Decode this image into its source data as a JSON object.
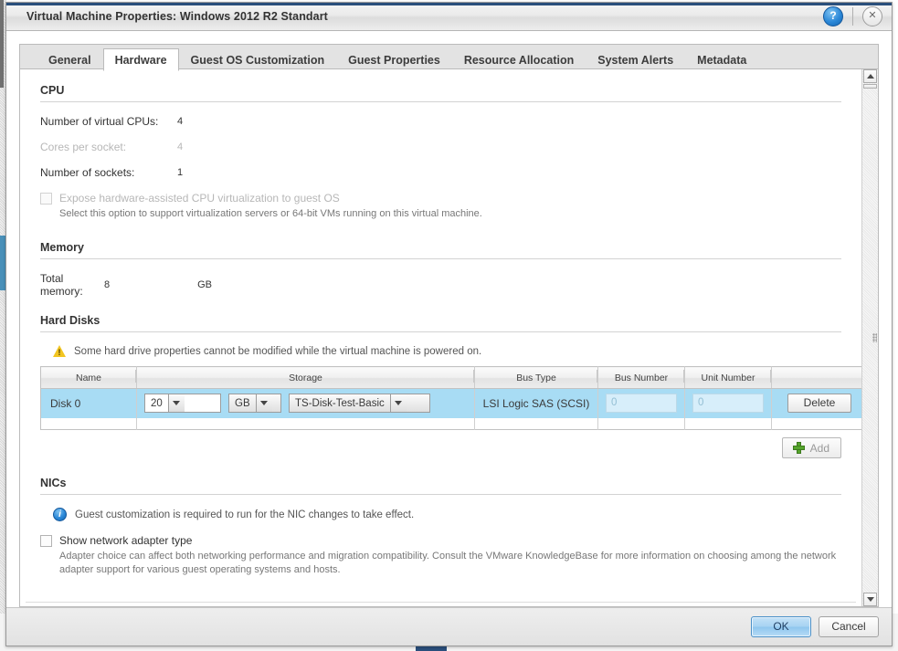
{
  "window": {
    "title": "Virtual Machine Properties: Windows 2012 R2 Standart",
    "help_icon": "help-circle-icon",
    "help_glyph": "?",
    "close_icon": "close-icon",
    "close_glyph": "✕"
  },
  "tabs": [
    {
      "label": "General",
      "active": false
    },
    {
      "label": "Hardware",
      "active": true
    },
    {
      "label": "Guest OS Customization",
      "active": false
    },
    {
      "label": "Guest Properties",
      "active": false
    },
    {
      "label": "Resource Allocation",
      "active": false
    },
    {
      "label": "System Alerts",
      "active": false
    },
    {
      "label": "Metadata",
      "active": false
    }
  ],
  "cpu": {
    "section_title": "CPU",
    "virtual_cpus_label": "Number of virtual CPUs:",
    "virtual_cpus_value": "4",
    "cores_per_socket_label": "Cores per socket:",
    "cores_per_socket_value": "4",
    "sockets_label": "Number of sockets:",
    "sockets_value": "1",
    "expose_hv_label": "Expose hardware-assisted CPU virtualization to guest OS",
    "expose_hv_hint": "Select this option to support virtualization servers or 64-bit VMs running on this virtual machine.",
    "expose_hv_checked": false
  },
  "memory": {
    "section_title": "Memory",
    "total_label": "Total memory:",
    "total_value": "8",
    "total_unit": "GB"
  },
  "hard_disks": {
    "section_title": "Hard Disks",
    "warning_icon": "warning-triangle-icon",
    "warning_text": "Some hard drive properties cannot be modified while the virtual machine is powered on.",
    "columns": [
      "Name",
      "Storage",
      "Bus Type",
      "Bus Number",
      "Unit Number",
      ""
    ],
    "rows": [
      {
        "name": "Disk 0",
        "size": "20",
        "unit": "GB",
        "storage_profile": "TS-Disk-Test-Basic",
        "bus_type": "LSI Logic SAS (SCSI)",
        "bus_number": "0",
        "unit_number": "0",
        "action_label": "Delete"
      }
    ],
    "add_label": "Add",
    "add_icon": "plus-icon"
  },
  "nics": {
    "section_title": "NICs",
    "info_icon": "info-circle-icon",
    "info_text": "Guest customization is required to run for the NIC changes to take effect.",
    "show_adapter_label": "Show network adapter type",
    "show_adapter_checked": false,
    "show_adapter_hint": "Adapter choice can affect both networking performance and migration compatibility. Consult the VMware KnowledgeBase for more information on choosing among the network adapter support for various guest operating systems and hosts."
  },
  "scrollbar": {
    "up_icon": "scroll-up-arrow-icon",
    "down_icon": "scroll-down-arrow-icon",
    "thumb": "scroll-thumb"
  },
  "footer": {
    "ok_label": "OK",
    "cancel_label": "Cancel"
  },
  "colors": {
    "accent": "#2a4f7c",
    "selection_row": "#a8dcf4",
    "primary_button": "#a7d3f2",
    "warning": "#f2c521",
    "info": "#2b88d8",
    "add_plus": "#55a52b"
  }
}
